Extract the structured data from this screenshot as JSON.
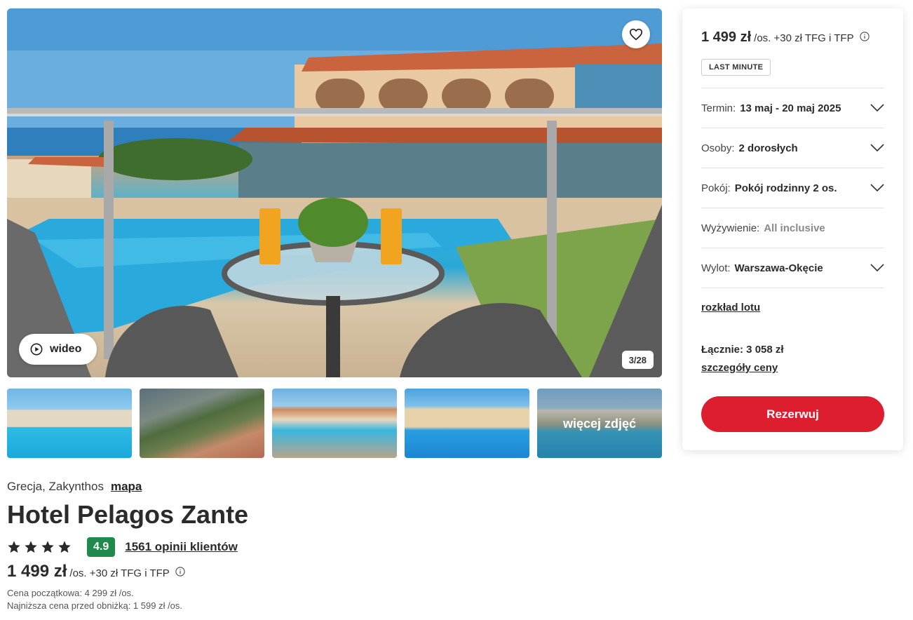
{
  "gallery": {
    "video_label": "wideo",
    "counter": "3/28",
    "more_photos_label": "więcej zdjęć"
  },
  "hotel": {
    "location": "Grecja, Zakynthos",
    "map_link": "mapa",
    "name": "Hotel Pelagos Zante",
    "stars": 4,
    "score": "4.9",
    "reviews_link": "1561 opinii klientów",
    "price": "1 499 zł",
    "price_unit": "/os. +30 zł TFG i TFP",
    "initial_price": "Cena początkowa: 4 299 zł /os.",
    "lowest_price": "Najniższa cena przed obniżką: 1 599 zł /os."
  },
  "booking": {
    "price": "1 499 zł",
    "price_unit": "/os. +30 zł TFG i TFP",
    "badge": "LAST MINUTE",
    "term_label": "Termin:",
    "term_value": "13 maj - 20 maj 2025",
    "persons_label": "Osoby:",
    "persons_value": "2 dorosłych",
    "room_label": "Pokój:",
    "room_value": "Pokój rodzinny 2 os.",
    "board_label": "Wyżywienie:",
    "board_value": "All inclusive",
    "departure_label": "Wylot:",
    "departure_value": "Warszawa-Okęcie",
    "flight_schedule_link": "rozkład lotu",
    "total": "Łącznie: 3 058 zł",
    "price_details_link": "szczegóły ceny",
    "reserve_button": "Rezerwuj"
  },
  "colors": {
    "accent_red": "#dd1e2e",
    "score_green": "#1f8a4c",
    "text_dark": "#2b2b2b"
  },
  "icons": [
    "heart-icon",
    "play-icon",
    "star-icon",
    "info-icon",
    "chevron-down-icon"
  ]
}
